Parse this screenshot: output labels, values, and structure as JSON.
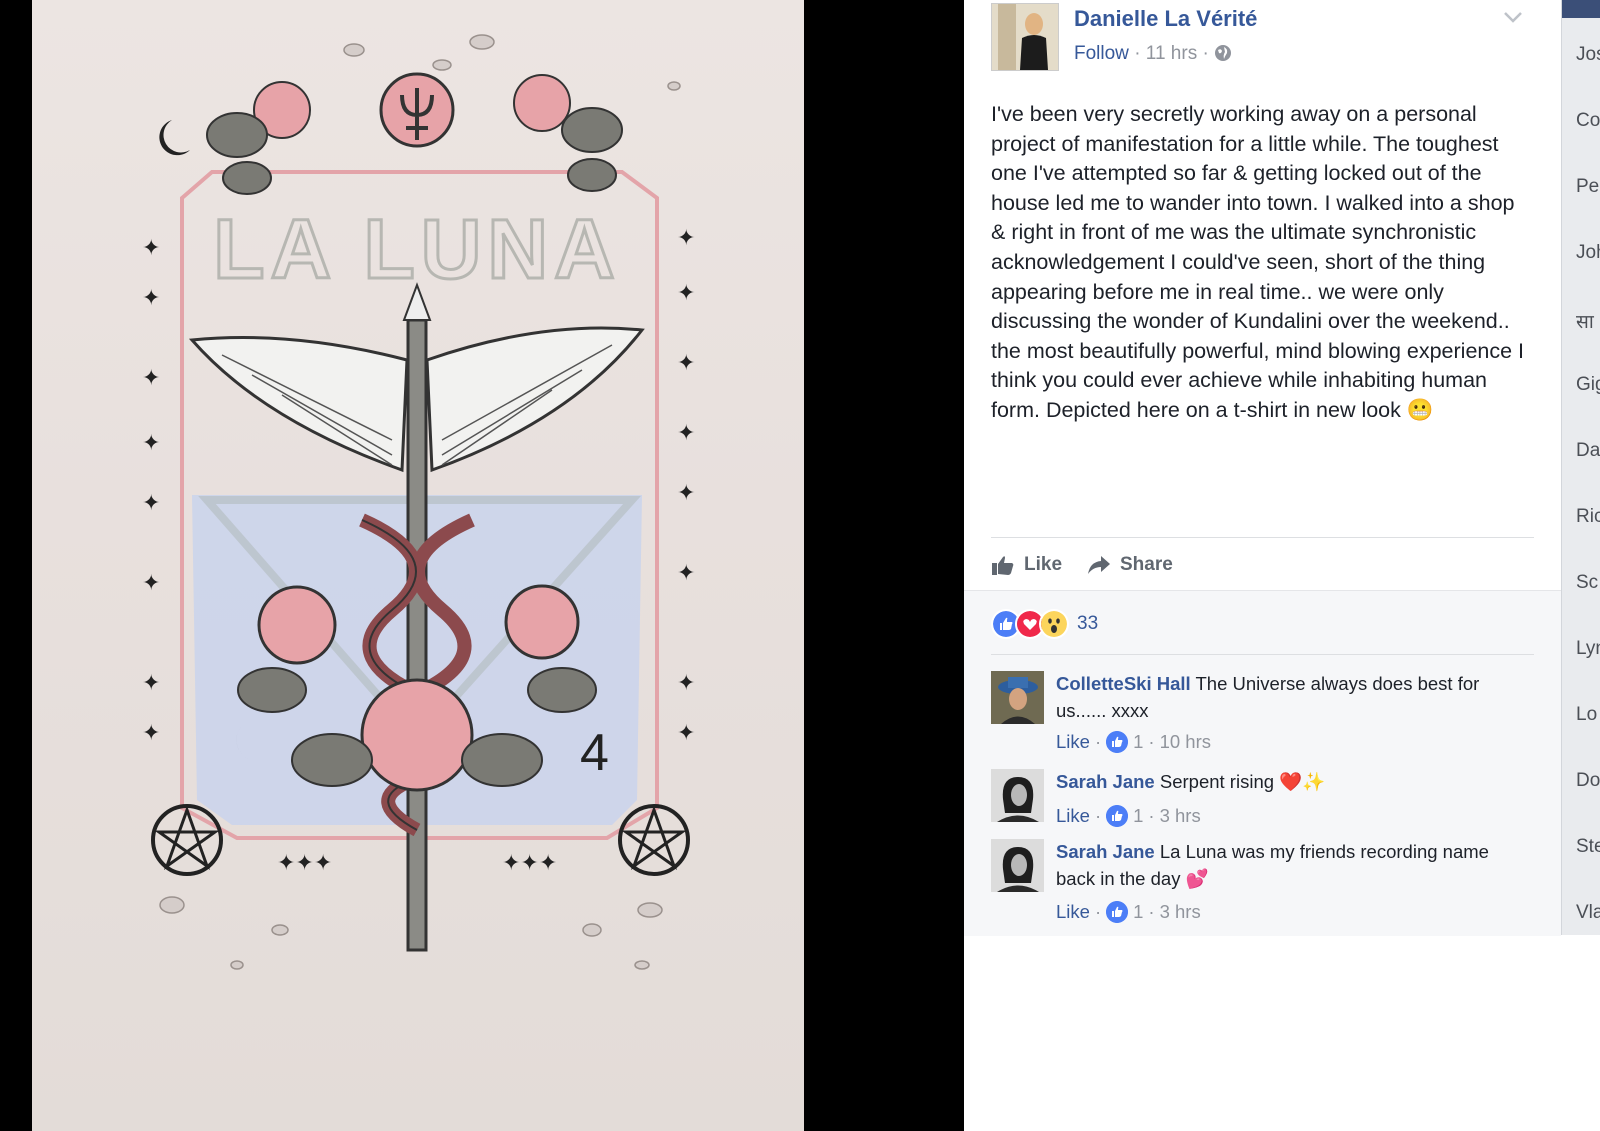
{
  "post": {
    "author": "Danielle La Vérité",
    "follow_label": "Follow",
    "timestamp": "11 hrs",
    "text": "I've been very secretly working away on a personal project of manifestation for a little while. The toughest one I've attempted so far & getting locked out of the house led me to wander into town. I walked into a shop & right in front of me was the ultimate synchronistic acknowledgement I could've seen, short of the thing appearing before me in real time.. we were only discussing the wonder of Kundalini over the weekend.. the most beautifully powerful, mind blowing experience I think you could ever achieve while inhabiting human form. Depicted here on a t-shirt in new look",
    "emoji": "😬"
  },
  "actions": {
    "like_label": "Like",
    "share_label": "Share"
  },
  "reactions": {
    "types": [
      "like",
      "love",
      "wow"
    ],
    "count": "33"
  },
  "comments": [
    {
      "author": "ColletteSki Hall",
      "text": "The Universe always does best for us...... xxxx",
      "like_label": "Like",
      "likes": "1",
      "time": "10 hrs",
      "emoji": ""
    },
    {
      "author": "Sarah Jane",
      "text": "Serpent rising",
      "like_label": "Like",
      "likes": "1",
      "time": "3 hrs",
      "emoji": "❤️✨"
    },
    {
      "author": "Sarah Jane",
      "text": "La Luna was my friends recording name back in the day",
      "like_label": "Like",
      "likes": "1",
      "time": "3 hrs",
      "emoji": "💕"
    }
  ],
  "shirt_print": {
    "text": "LA LUNA"
  },
  "sidebar_items": [
    "Jos",
    "Co",
    "Pe",
    "Joh",
    "सा",
    "Gig",
    "Da",
    "Ric",
    "Sc",
    "Lyn",
    "Lo",
    "Do",
    "Ste",
    "Vla"
  ],
  "colors": {
    "link": "#365899",
    "meta": "#90949c",
    "text": "#1d2129",
    "like_blue": "#4c7ef7"
  },
  "icons": [
    "chevron-down-icon",
    "globe-icon",
    "thumbs-up-icon",
    "share-arrow-icon",
    "like-reaction-icon",
    "love-reaction-icon",
    "wow-reaction-icon"
  ]
}
